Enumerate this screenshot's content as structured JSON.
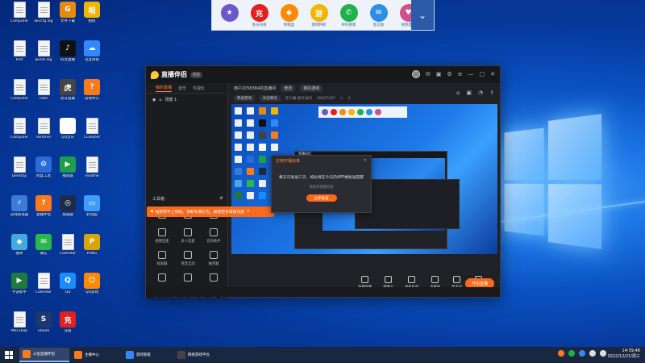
{
  "desktop": {
    "icons": [
      {
        "label": "Computer",
        "type": "doc"
      },
      {
        "label": "wincfg.log",
        "type": "doc"
      },
      {
        "label": "文件下载",
        "type": "app",
        "color": "#e58a0c",
        "glyph": "G"
      },
      {
        "label": "拍照",
        "type": "app",
        "color": "#f0b400",
        "glyph": "相"
      },
      {
        "label": "test",
        "type": "doc"
      },
      {
        "label": "winnt.log",
        "type": "doc"
      },
      {
        "label": "抖音直播",
        "type": "app",
        "color": "#111111",
        "glyph": "♪"
      },
      {
        "label": "百度网盘",
        "type": "app",
        "color": "#3388ff",
        "glyph": "☁"
      },
      {
        "label": "Computer",
        "type": "doc"
      },
      {
        "label": "note",
        "type": "doc"
      },
      {
        "label": "虎牙直播",
        "type": "app",
        "color": "#444444",
        "glyph": "虎"
      },
      {
        "label": "游戏中心",
        "type": "app",
        "color": "#ff7a1a",
        "glyph": "?"
      },
      {
        "label": "Computer",
        "type": "doc"
      },
      {
        "label": "sentinel",
        "type": "doc"
      },
      {
        "label": "QQ音乐",
        "type": "app",
        "color": "#ffffff",
        "glyph": "♫"
      },
      {
        "label": "CCleaner",
        "type": "doc"
      },
      {
        "label": "Desktop",
        "type": "doc"
      },
      {
        "label": "修复工具",
        "type": "app",
        "color": "#2b6bd8",
        "glyph": "⚙"
      },
      {
        "label": "播放器",
        "type": "app",
        "color": "#1f9e4a",
        "glyph": "▶"
      },
      {
        "label": "readme",
        "type": "doc"
      },
      {
        "label": "游戏加速器",
        "type": "app",
        "color": "#3a7bd5",
        "glyph": "⚡"
      },
      {
        "label": "直播伴侣",
        "type": "app",
        "color": "#ff7a1a",
        "glyph": "?"
      },
      {
        "label": "加速器",
        "type": "app",
        "color": "#1e2b44",
        "glyph": "◎"
      },
      {
        "label": "此电脑",
        "type": "app",
        "color": "#3f9cff",
        "glyph": "▭"
      },
      {
        "label": "图库",
        "type": "app",
        "color": "#44aadd",
        "glyph": "◆"
      },
      {
        "label": "微信",
        "type": "app",
        "color": "#2ab84a",
        "glyph": "✉"
      },
      {
        "label": "Calendar",
        "type": "doc"
      },
      {
        "label": "PUBG",
        "type": "app",
        "color": "#d8a400",
        "glyph": "P"
      },
      {
        "label": "手游助手",
        "type": "app",
        "color": "#1f7a3c",
        "glyph": "▶"
      },
      {
        "label": "Calendar",
        "type": "doc"
      },
      {
        "label": "QQ",
        "type": "app",
        "color": "#1a8cff",
        "glyph": "Q"
      },
      {
        "label": "QQ游戏",
        "type": "app",
        "color": "#ff8a00",
        "glyph": "☺"
      },
      {
        "label": "MSCHelp",
        "type": "doc"
      },
      {
        "label": "Steam",
        "type": "app",
        "color": "#1b3a6b",
        "glyph": "S"
      },
      {
        "label": "充值",
        "type": "app",
        "color": "#e2201f",
        "glyph": "充"
      }
    ]
  },
  "topbar": {
    "items": [
      {
        "label": "",
        "color": "#6b59c9",
        "glyph": "★"
      },
      {
        "label": "会员充值",
        "color": "#e2201f",
        "glyph": "充"
      },
      {
        "label": "购物盒",
        "color": "#ff8a00",
        "glyph": "◆"
      },
      {
        "label": "游戏特权",
        "color": "#f5b400",
        "glyph": "游"
      },
      {
        "label": "呼叫管家",
        "color": "#1fb14a",
        "glyph": "✆"
      },
      {
        "label": "留言板",
        "color": "#2d8ee8",
        "glyph": "✉"
      },
      {
        "label": "视频直播",
        "color": "#d0508c",
        "glyph": "♥"
      }
    ]
  },
  "app": {
    "title": "直播伴侣",
    "version": "新版",
    "left_tabs": [
      "我的直播",
      "音乐",
      "可视化"
    ],
    "scene": "场景 1",
    "toolbox_title": "工具箱",
    "tools": [
      {
        "label": "",
        "name": "tool-1"
      },
      {
        "label": "",
        "name": "tool-2"
      },
      {
        "label": "",
        "name": "tool-3"
      },
      {
        "label": "视频连麦",
        "name": "tool-video-link"
      },
      {
        "label": "多人连麦",
        "name": "tool-multi-link"
      },
      {
        "label": "音乐助手",
        "name": "tool-music"
      },
      {
        "label": "投屏器",
        "name": "tool-cast"
      },
      {
        "label": "语音互动",
        "name": "tool-voice"
      },
      {
        "label": "抽奖器",
        "name": "tool-lottery"
      },
      {
        "label": "",
        "name": "tool-10"
      },
      {
        "label": "",
        "name": "tool-11"
      },
      {
        "label": "",
        "name": "tool-12"
      }
    ],
    "banner": "推荐新手上线啦，领取专属礼包，解锁更多高级功能",
    "notice": "1.老公众，领你无限可能，直播有很多，抓上一定领",
    "room_title": "用户2058384的直播间",
    "room_edit": "修改",
    "room_chip": "我的游戏",
    "room_tags": [
      "熟悉游戏",
      "综合聊天"
    ],
    "room_meta": "在人数 统计访问",
    "room_id": "10627297",
    "room_hot": "0",
    "dialog": {
      "title": "达到开播标准",
      "body": "每天可发送三次，如此将在今天的APP端发送提醒",
      "sub": "请选择提醒内容",
      "button": "立即发送"
    },
    "bottom_tools": [
      "直播屏幕",
      "摄像头",
      "手机投屏",
      "多媒体",
      "麦克风",
      "扬声器"
    ],
    "live_button": "开始直播",
    "stats": [
      "CPU 0%",
      "内存 0%",
      "上传 0KB/S",
      "下载 0KB/S"
    ],
    "time": "00:00:02",
    "end_time": "00:00:00"
  },
  "taskbar": {
    "tasks": [
      {
        "label": "斗鱼直播伴侣",
        "color": "#ff7a1a",
        "active": true
      },
      {
        "label": "主播中心",
        "color": "#ff7a1a",
        "active": false
      },
      {
        "label": "游戏管家",
        "color": "#3388ff",
        "active": false
      },
      {
        "label": "网易游戏平台",
        "color": "#444444",
        "active": false
      }
    ],
    "time": "14:59:48",
    "date": "2022/12/21/周三"
  }
}
